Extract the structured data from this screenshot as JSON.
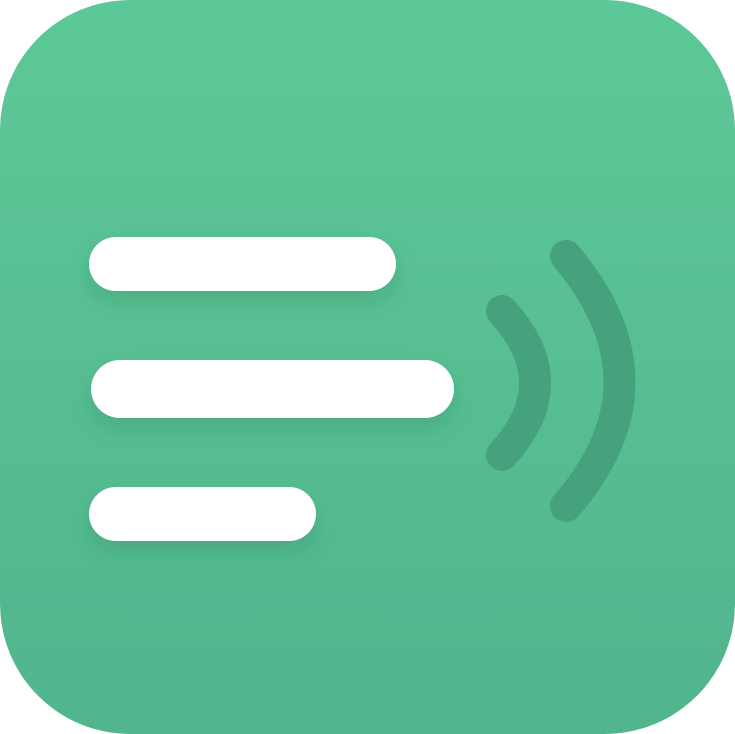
{
  "icon": {
    "name": "text-to-speech-app-icon",
    "glyph": "text-lines-with-sound-waves-icon",
    "colors": {
      "background_top": "#5DC897",
      "background_bottom": "#51B58D",
      "text_lines": "#FFFFFF",
      "sound_waves": "#45A27C"
    }
  }
}
